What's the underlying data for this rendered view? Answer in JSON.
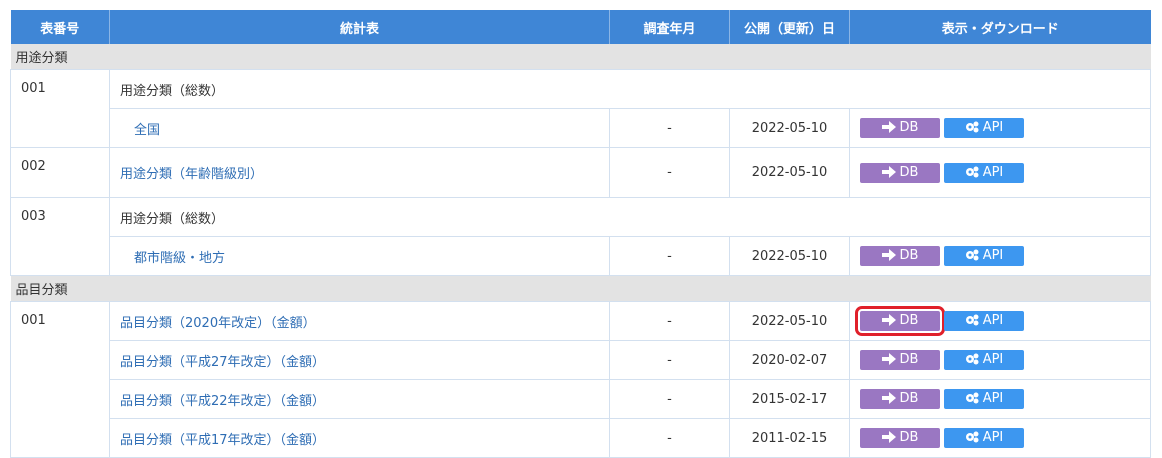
{
  "headers": [
    "表番号",
    "統計表",
    "調査年月",
    "公開（更新）日",
    "表示・ダウンロード"
  ],
  "buttons": {
    "db": "DB",
    "api": "API"
  },
  "sections": [
    {
      "label": "用途分類"
    },
    {
      "label": "品目分類"
    }
  ],
  "rows": [
    {
      "num": "001",
      "title": "用途分類（総数）"
    },
    {
      "title": "全国",
      "survey": "-",
      "date": "2022-05-10"
    },
    {
      "num": "002",
      "title": "用途分類（年齢階級別）",
      "survey": "-",
      "date": "2022-05-10"
    },
    {
      "num": "003",
      "title": "用途分類（総数）"
    },
    {
      "title": "都市階級・地方",
      "survey": "-",
      "date": "2022-05-10"
    },
    {
      "num": "001",
      "title": "品目分類（2020年改定）（金額）",
      "survey": "-",
      "date": "2022-05-10"
    },
    {
      "title": "品目分類（平成27年改定）（金額）",
      "survey": "-",
      "date": "2020-02-07"
    },
    {
      "title": "品目分類（平成22年改定）（金額）",
      "survey": "-",
      "date": "2015-02-17"
    },
    {
      "title": "品目分類（平成17年改定）（金額）",
      "survey": "-",
      "date": "2011-02-15"
    }
  ],
  "colors": {
    "header": "#3f86d6",
    "db": "#9a77c2",
    "api": "#3d97f0",
    "section": "#e3e3e3",
    "link": "#2e6db4",
    "highlight": "#e0202a"
  }
}
